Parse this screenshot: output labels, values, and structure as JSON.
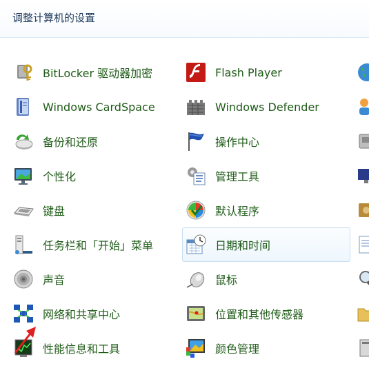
{
  "header": {
    "title": "调整计算机的设置"
  },
  "col1": [
    {
      "label": "BitLocker 驱动器加密",
      "icon": "bitlocker-key-icon"
    },
    {
      "label": "Windows CardSpace",
      "icon": "cardspace-icon"
    },
    {
      "label": "备份和还原",
      "icon": "backup-restore-icon"
    },
    {
      "label": "个性化",
      "icon": "personalization-icon"
    },
    {
      "label": "键盘",
      "icon": "keyboard-icon"
    },
    {
      "label": "任务栏和「开始」菜单",
      "icon": "taskbar-start-icon"
    },
    {
      "label": "声音",
      "icon": "sound-icon"
    },
    {
      "label": "网络和共享中心",
      "icon": "network-sharing-icon"
    },
    {
      "label": "性能信息和工具",
      "icon": "performance-icon"
    }
  ],
  "col2": [
    {
      "label": "Flash Player",
      "icon": "flash-player-icon"
    },
    {
      "label": "Windows Defender",
      "icon": "windows-defender-icon"
    },
    {
      "label": "操作中心",
      "icon": "action-center-flag-icon"
    },
    {
      "label": "管理工具",
      "icon": "admin-tools-icon"
    },
    {
      "label": "默认程序",
      "icon": "default-programs-icon"
    },
    {
      "label": "日期和时间",
      "icon": "date-time-icon"
    },
    {
      "label": "鼠标",
      "icon": "mouse-icon"
    },
    {
      "label": "位置和其他传感器",
      "icon": "location-sensors-icon"
    },
    {
      "label": "颜色管理",
      "icon": "color-management-icon"
    }
  ],
  "colors": {
    "label": "#1e5b17",
    "title": "#1e395b",
    "hover_border": "#c7def2",
    "arrow": "#e02020"
  },
  "annotation": {
    "icon": "red-arrow-icon"
  }
}
